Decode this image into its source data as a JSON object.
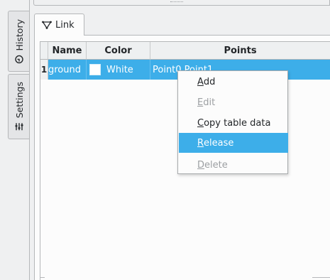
{
  "side_tabs": [
    {
      "label": "History",
      "icon": "history-icon"
    },
    {
      "label": "Settings",
      "icon": "sliders-icon"
    }
  ],
  "tab": {
    "label": "Link",
    "icon": "link-icon"
  },
  "table": {
    "columns": [
      "Name",
      "Color",
      "Points"
    ],
    "rows": [
      {
        "number": "1",
        "name": "ground",
        "color_name": "White",
        "color_hex": "#ffffff",
        "points": "Point0,Point1"
      }
    ]
  },
  "context_menu": {
    "items": [
      {
        "label": "Add",
        "mnemonic": "A",
        "rest": "dd",
        "enabled": true,
        "highlighted": false
      },
      {
        "label": "Edit",
        "mnemonic": "E",
        "rest": "dit",
        "enabled": false,
        "highlighted": false
      },
      {
        "label": "Copy table data",
        "mnemonic": "C",
        "rest": "opy table data",
        "enabled": true,
        "highlighted": false
      },
      {
        "label": "Release",
        "mnemonic": "R",
        "rest": "elease",
        "enabled": true,
        "highlighted": true
      },
      {
        "label": "Delete",
        "mnemonic": "D",
        "rest": "elete",
        "enabled": false,
        "highlighted": false
      }
    ]
  },
  "colors": {
    "accent": "#3daee9",
    "window": "#eff0f1",
    "view": "#fcfcfc",
    "border": "#b5b7b9",
    "disabled_text": "#9c9fa2"
  }
}
